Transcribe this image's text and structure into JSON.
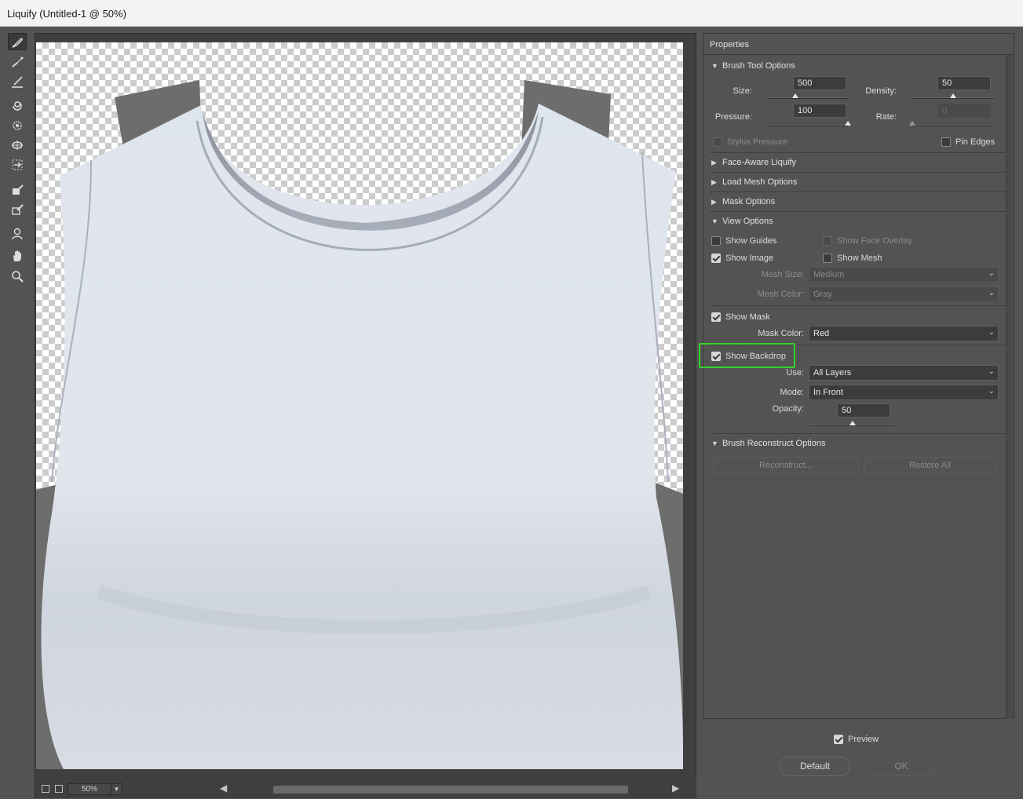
{
  "window": {
    "title": "Liquify (Untitled-1 @ 50%)"
  },
  "tools": [
    {
      "name": "forward-warp-tool-icon",
      "active": true
    },
    {
      "name": "reconstruct-tool-icon"
    },
    {
      "name": "smooth-tool-icon"
    },
    {
      "name": "twirl-clockwise-tool-icon"
    },
    {
      "name": "pucker-tool-icon"
    },
    {
      "name": "bloat-tool-icon"
    },
    {
      "name": "push-left-tool-icon"
    },
    {
      "name": "freeze-mask-tool-icon"
    },
    {
      "name": "thaw-mask-tool-icon"
    },
    {
      "name": "face-tool-icon"
    },
    {
      "name": "hand-tool-icon"
    },
    {
      "name": "zoom-tool-icon"
    }
  ],
  "statusbar": {
    "zoom": "50%"
  },
  "properties": {
    "title": "Properties",
    "brush_tool_options": {
      "header": "Brush Tool Options",
      "size_label": "Size:",
      "size_value": "500",
      "size_fraction": 0.34,
      "density_label": "Density:",
      "density_value": "50",
      "density_fraction": 0.5,
      "pressure_label": "Pressure:",
      "pressure_value": "100",
      "pressure_fraction": 1.0,
      "rate_label": "Rate:",
      "rate_value": "0",
      "rate_fraction": 0.0,
      "stylus_pressure_label": "Stylus Pressure",
      "pin_edges_label": "Pin Edges"
    },
    "face_aware_header": "Face-Aware Liquify",
    "load_mesh_header": "Load Mesh Options",
    "mask_options_header": "Mask Options",
    "view_options": {
      "header": "View Options",
      "show_guides": "Show Guides",
      "show_face_overlay": "Show Face Overlay",
      "show_image": "Show Image",
      "show_mesh": "Show Mesh",
      "mesh_size_label": "Mesh Size:",
      "mesh_size_value": "Medium",
      "mesh_color_label": "Mesh Color:",
      "mesh_color_value": "Gray",
      "show_mask": "Show Mask",
      "mask_color_label": "Mask Color:",
      "mask_color_value": "Red",
      "show_backdrop": "Show Backdrop",
      "use_label": "Use:",
      "use_value": "All Layers",
      "mode_label": "Mode:",
      "mode_value": "In Front",
      "opacity_label": "Opacity:",
      "opacity_value": "50",
      "opacity_fraction": 0.5
    },
    "brush_reconstruct": {
      "header": "Brush Reconstruct Options",
      "reconstruct_label": "Reconstruct...",
      "restore_all_label": "Restore All"
    }
  },
  "footer": {
    "preview_label": "Preview",
    "default_label": "Default",
    "ok_label": "OK"
  },
  "colors": {
    "highlight": "#35d12a",
    "panel": "#535353"
  }
}
